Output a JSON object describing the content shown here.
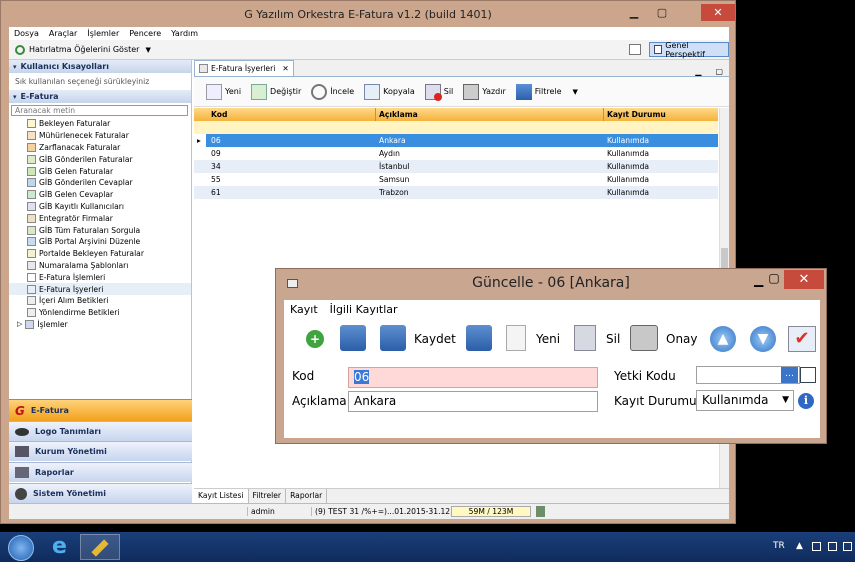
{
  "window": {
    "title": "G Yazılım Orkestra E-Fatura v1.2 (build 1401)"
  },
  "menu": [
    "Dosya",
    "Araçlar",
    "İşlemler",
    "Pencere",
    "Yardım"
  ],
  "toolbar1": {
    "reminder_label": "Hatırlatma Öğelerini Göster",
    "perspective_label": "Genel Perspektif"
  },
  "left": {
    "shortcuts_title": "Kullanıcı Kısayolları",
    "shortcuts_hint": "Sık kullanılan seçeneği sürükleyiniz",
    "efatura_title": "E-Fatura",
    "search_placeholder": "Aranacak metin",
    "items": [
      "Bekleyen Faturalar",
      "Mühürlenecek Faturalar",
      "Zarflanacak Faturalar",
      "GİB Gönderilen Faturalar",
      "GİB Gelen Faturalar",
      "GİB Gönderilen Cevaplar",
      "GİB Gelen Cevaplar",
      "GİB Kayıtlı Kullanıcıları",
      "Entegratör Firmalar",
      "GİB Tüm Faturaları Sorgula",
      "GİB Portal Arşivini Düzenle",
      "Portalde Bekleyen Faturalar",
      "Numaralama Şablonları",
      "E-Fatura İşlemleri",
      "E-Fatura İşyerleri",
      "İçeri Alım Betikleri",
      "Yönlendirme Betikleri",
      "İşlemler"
    ],
    "nav": [
      "E-Fatura",
      "Logo Tanımları",
      "Kurum Yönetimi",
      "Raporlar",
      "Sistem Yönetimi"
    ]
  },
  "editor": {
    "tab_label": "E-Fatura İşyerleri",
    "toolbar": [
      "Yeni",
      "Değiştir",
      "İncele",
      "Kopyala",
      "Sil",
      "Yazdır",
      "Filtrele"
    ],
    "columns": [
      "Kod",
      "Açıklama",
      "Kayıt Durumu"
    ],
    "rows": [
      {
        "kod": "06",
        "aciklama": "Ankara",
        "durum": "Kullanımda"
      },
      {
        "kod": "09",
        "aciklama": "Aydın",
        "durum": "Kullanımda"
      },
      {
        "kod": "34",
        "aciklama": "İstanbul",
        "durum": "Kullanımda"
      },
      {
        "kod": "55",
        "aciklama": "Samsun",
        "durum": "Kullanımda"
      },
      {
        "kod": "61",
        "aciklama": "Trabzon",
        "durum": "Kullanımda"
      }
    ],
    "bottom_tabs": [
      "Kayıt Listesi",
      "Filtreler",
      "Raporlar"
    ]
  },
  "status": {
    "user": "admin",
    "period": "(9) TEST 31 /%+=)...01.2015-31.12.2015",
    "memory": "59M / 123M"
  },
  "dialog": {
    "title": "Güncelle - 06 [Ankara]",
    "menu": [
      "Kayıt",
      "İlgili Kayıtlar"
    ],
    "tb_kaydet": "Kaydet",
    "tb_yeni": "Yeni",
    "tb_sil": "Sil",
    "tb_onay": "Onay",
    "kod_label": "Kod",
    "kod_value": "06",
    "aciklama_label": "Açıklama",
    "aciklama_value": "Ankara",
    "yetki_label": "Yetki Kodu",
    "kayit_label": "Kayıt Durumu",
    "kayit_value": "Kullanımda"
  },
  "taskbar": {
    "lang": "TR"
  }
}
